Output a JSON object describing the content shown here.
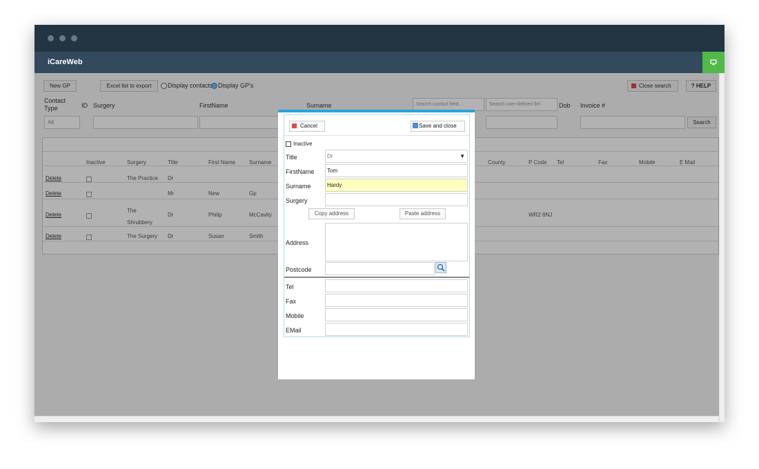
{
  "app": {
    "title": "iCareWeb"
  },
  "toolbar": {
    "new_gp": "New GP",
    "excel": "Excel list to export",
    "radio_contacts": "Display contacts",
    "radio_gps": "Display GP's",
    "close_search": "Close search",
    "help": "? HELP"
  },
  "filters": {
    "contact_type": "Contact Type",
    "id": "ID",
    "surgery": "Surgery",
    "firstname": "FirstName",
    "surname": "Surname",
    "dob": "Dob",
    "invoice": "Invoice #",
    "contact_type_value": "All",
    "search_contact_placeholder": "Search contact field...",
    "search_user_placeholder": "Search user-defined fiel",
    "search_button": "Search"
  },
  "grid": {
    "headers": [
      "Inactive",
      "Surgery",
      "Title",
      "First Name",
      "Surname",
      "County",
      "P Code",
      "Tel",
      "Fax",
      "Mobile",
      "E Mail"
    ],
    "delete_label": "Delete",
    "rows": [
      {
        "surgery": "The Practice",
        "title": "Dr",
        "first": "",
        "surname": "",
        "pcode": ""
      },
      {
        "surgery": "",
        "title": "Mr",
        "first": "New",
        "surname": "Gp",
        "pcode": ""
      },
      {
        "surgery": "The Shrubbery",
        "title": "Dr",
        "first": "Philip",
        "surname": "McCavity",
        "pcode": "WR2 6NJ"
      },
      {
        "surgery": "The Surgery",
        "title": "Dr",
        "first": "Susan",
        "surname": "Smith",
        "pcode": ""
      }
    ]
  },
  "modal": {
    "cancel": "Cancel",
    "save": "Save and close",
    "inactive": "Inactive",
    "title_label": "Title",
    "title_value": "Dr",
    "firstname_label": "FirstName",
    "firstname_value": "Tom",
    "surname_label": "Surname",
    "surname_value": "Hardy",
    "surgery_label": "Surgery",
    "copy_address": "Copy address",
    "paste_address": "Paste address",
    "address_label": "Address",
    "postcode_label": "Postcode",
    "tel_label": "Tel",
    "fax_label": "Fax",
    "mobile_label": "Mobile",
    "email_label": "EMail"
  },
  "colors": {
    "accent": "#29a3db",
    "titlebar": "#233443",
    "appbar": "#33495d",
    "green": "#52b848",
    "highlight": "#ffffc0"
  }
}
